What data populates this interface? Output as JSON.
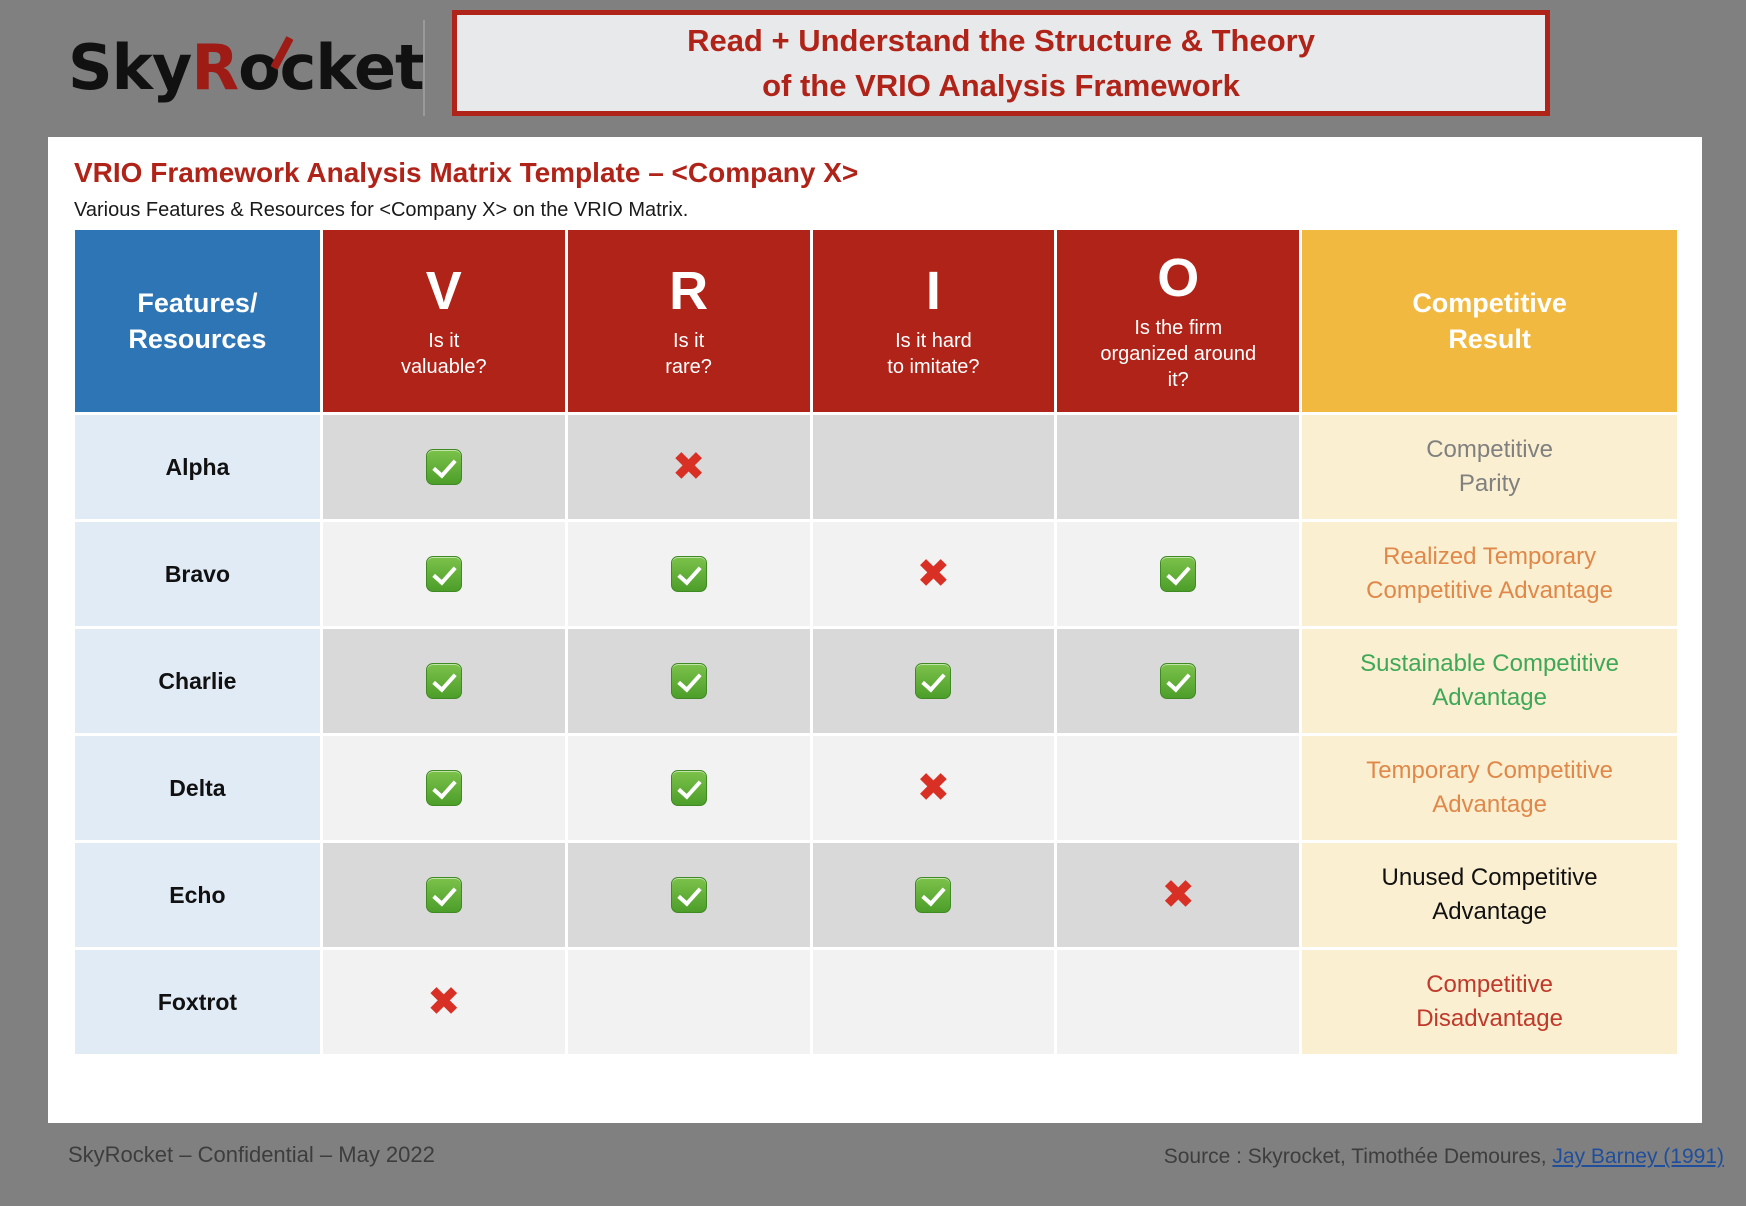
{
  "brand": {
    "logo_prefix": "Sky",
    "logo_r": "R",
    "logo_suffix": "ocket"
  },
  "banner": {
    "line1": "Read + Understand the Structure & Theory",
    "line2": "of the VRIO Analysis Framework",
    "text_color": "#B02318",
    "bg_color": "#E8E9EB"
  },
  "slide": {
    "title": "VRIO Framework Analysis Matrix Template – <Company X>",
    "subtitle": "Various Features & Resources for <Company X> on the VRIO Matrix."
  },
  "table": {
    "header": {
      "features": {
        "line1": "Features/",
        "line2": "Resources",
        "bg": "#2E75B6"
      },
      "columns": [
        {
          "letter": "V",
          "question_line1": "Is it",
          "question_line2": "valuable?",
          "question_line3": ""
        },
        {
          "letter": "R",
          "question_line1": "Is it",
          "question_line2": "rare?",
          "question_line3": ""
        },
        {
          "letter": "I",
          "question_line1": "Is it hard",
          "question_line2": "to imitate?",
          "question_line3": ""
        },
        {
          "letter": "O",
          "question_line1": "Is the firm",
          "question_line2": "organized around",
          "question_line3": "it?"
        }
      ],
      "result": {
        "line1": "Competitive",
        "line2": "Result",
        "bg": "#F2B941"
      }
    },
    "rows": [
      {
        "name": "Alpha",
        "marks": [
          "check",
          "cross",
          "blank",
          "blank"
        ],
        "result_line1": "Competitive",
        "result_line2": "Parity",
        "result_color": "#808080"
      },
      {
        "name": "Bravo",
        "marks": [
          "check",
          "check",
          "cross",
          "check"
        ],
        "result_line1": "Realized Temporary",
        "result_line2": "Competitive Advantage",
        "result_color": "#E0884A"
      },
      {
        "name": "Charlie",
        "marks": [
          "check",
          "check",
          "check",
          "check"
        ],
        "result_line1": "Sustainable Competitive",
        "result_line2": "Advantage",
        "result_color": "#3FA858"
      },
      {
        "name": "Delta",
        "marks": [
          "check",
          "check",
          "cross",
          "blank"
        ],
        "result_line1": "Temporary Competitive",
        "result_line2": "Advantage",
        "result_color": "#E0884A"
      },
      {
        "name": "Echo",
        "marks": [
          "check",
          "check",
          "check",
          "cross"
        ],
        "result_line1": "Unused Competitive",
        "result_line2": "Advantage",
        "result_color": "#111111"
      },
      {
        "name": "Foxtrot",
        "marks": [
          "cross",
          "blank",
          "blank",
          "blank"
        ],
        "result_line1": "Competitive",
        "result_line2": "Disadvantage",
        "result_color": "#C0392B"
      }
    ]
  },
  "footer": {
    "left": "SkyRocket – Confidential – May 2022",
    "source_prefix": "Source : Skyrocket, Timothée Demoures,",
    "source_link": "Jay Barney (1991)"
  }
}
